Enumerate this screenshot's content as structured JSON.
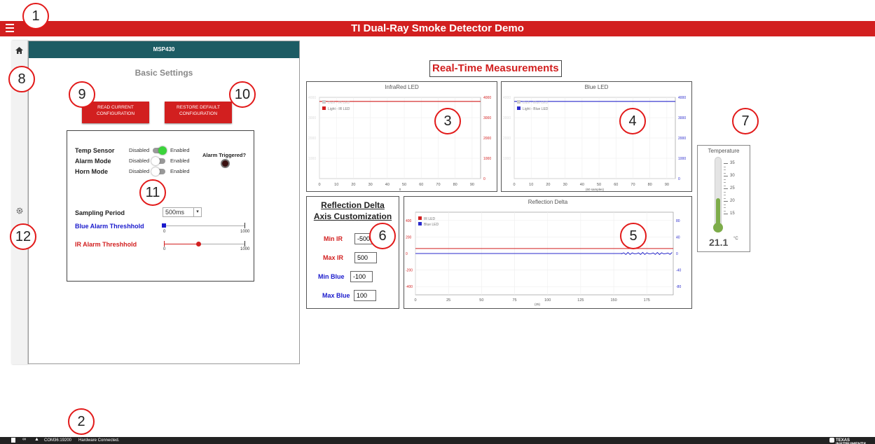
{
  "app": {
    "title": "TI Dual-Ray Smoke Detector Demo"
  },
  "callouts": [
    "1",
    "2",
    "3",
    "4",
    "5",
    "6",
    "7",
    "8",
    "9",
    "10",
    "11",
    "12"
  ],
  "sidebar": {
    "items": [
      {
        "icon": "home-icon"
      },
      {
        "icon": "gear-icon"
      }
    ]
  },
  "panel": {
    "header": "MSP430",
    "section_title": "Basic Settings",
    "read_button": "READ CURRENT CONFIGURATION",
    "restore_button": "RESTORE DEFAULT CONFIGURATION",
    "temp_sensor_label": "Temp Sensor",
    "alarm_mode_label": "Alarm Mode",
    "horn_mode_label": "Horn Mode",
    "disabled": "Disabled",
    "enabled": "Enabled",
    "temp_sensor_on": true,
    "alarm_mode_on": false,
    "horn_mode_on": false,
    "alarm_triggered_label": "Alarm Triggered?",
    "sampling_period_label": "Sampling Period",
    "sampling_period_value": "500ms",
    "blue_alarm_label": "Blue Alarm Threshhold",
    "ir_alarm_label": "IR Alarm Threshhold",
    "slider_min": "0",
    "slider_max": "1000",
    "blue_alarm_value": 0,
    "ir_alarm_value": 0.42,
    "colors": {
      "blue": "#1a1acc",
      "red": "#d21f1f",
      "green": "#3bd43b"
    }
  },
  "main": {
    "title": "Real-Time Measurements",
    "ir_chart": {
      "title": "InfraRed LED",
      "legend": [
        "Dark - IR LED",
        "Light - IR LED"
      ],
      "x_ticks": [
        "0",
        "10",
        "20",
        "30",
        "40",
        "50",
        "60",
        "70",
        "80",
        "90"
      ],
      "x_label": "0",
      "y_left": [
        "4000",
        "3000",
        "2000",
        "1000"
      ],
      "y_right": [
        "4000",
        "3000",
        "2000",
        "1000",
        "0"
      ],
      "line_value": 3800
    },
    "blue_chart": {
      "title": "Blue LED",
      "legend": [
        "Dark - Blue LED",
        "Light - Blue LED"
      ],
      "x_ticks": [
        "0",
        "10",
        "20",
        "30",
        "40",
        "50",
        "60",
        "70",
        "80",
        "90"
      ],
      "x_label": "(60 samples)",
      "y_left": [
        "4000",
        "3000",
        "2000",
        "1000"
      ],
      "y_right": [
        "4000",
        "3000",
        "2000",
        "1000",
        "0"
      ],
      "line_value": 3800
    },
    "delta_chart": {
      "title": "Reflection Delta",
      "legend": [
        "IR LED",
        "Blue LED"
      ],
      "x_ticks": [
        "0",
        "25",
        "50",
        "75",
        "100",
        "125",
        "150",
        "175"
      ],
      "x_label": "(25)",
      "y_left": [
        "400",
        "200",
        "0",
        "-200",
        "-400"
      ],
      "y_right": [
        "80",
        "40",
        "0",
        "-40",
        "-80"
      ],
      "ir_value": 60,
      "blue_value": 0
    },
    "axis_custom": {
      "title_line1": "Reflection Delta",
      "title_line2": "Axis Customization",
      "min_ir_label": "Min IR",
      "max_ir_label": "Max IR",
      "min_blue_label": "Min Blue",
      "max_blue_label": "Max Blue",
      "min_ir": "-500",
      "max_ir": "500",
      "min_blue": "-100",
      "max_blue": "100"
    },
    "temperature": {
      "title": "Temperature",
      "ticks": [
        "35",
        "30",
        "25",
        "20",
        "15"
      ],
      "value": "21.1",
      "unit": "°C"
    }
  },
  "status": {
    "port": "COM36:19200",
    "state": "Hardware Connected.",
    "brand": "TEXAS INSTRUMENTS"
  }
}
